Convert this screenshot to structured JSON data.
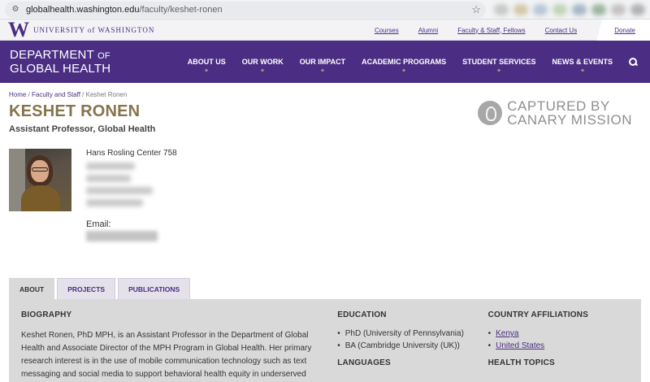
{
  "browser": {
    "url_host": "globalhealth.washington.edu",
    "url_path": "/faculty/keshet-ronen"
  },
  "util_nav": {
    "uw_name": "UNIVERSITY of WASHINGTON",
    "links": [
      "Courses",
      "Alumni",
      "Faculty & Staff, Fellows",
      "Contact Us"
    ],
    "donate": "Donate"
  },
  "header": {
    "dept_line1": "DEPARTMENT",
    "dept_of": "OF",
    "dept_line2": "GLOBAL HEALTH",
    "nav": [
      "ABOUT US",
      "OUR WORK",
      "OUR IMPACT",
      "ACADEMIC PROGRAMS",
      "STUDENT SERVICES",
      "NEWS & EVENTS"
    ]
  },
  "breadcrumb": {
    "home": "Home",
    "faculty": "Faculty and Staff",
    "current": "Keshet Ronen"
  },
  "profile": {
    "name": "KESHET RONEN",
    "title": "Assistant Professor, Global Health",
    "office": "Hans Rosling Center 758",
    "email_label": "Email:"
  },
  "watermark": {
    "line1": "CAPTURED BY",
    "line2": "CANARY MISSION"
  },
  "tabs": [
    "ABOUT",
    "PROJECTS",
    "PUBLICATIONS"
  ],
  "about": {
    "bio_heading": "BIOGRAPHY",
    "bio_text": "Keshet Ronen, PhD MPH, is an Assistant Professor in the Department of Global Health and Associate Director of the MPH Program in Global Health. Her primary research interest is in the use of mobile communication technology such as text messaging and social media to support behavioral health equity in underserved",
    "edu_heading": "EDUCATION",
    "education": [
      "PhD (University of Pennsylvania)",
      "BA (Cambridge University (UK))"
    ],
    "lang_heading": "LANGUAGES",
    "country_heading": "COUNTRY AFFILIATIONS",
    "countries": [
      "Kenya",
      "United States"
    ],
    "health_heading": "HEALTH TOPICS"
  }
}
